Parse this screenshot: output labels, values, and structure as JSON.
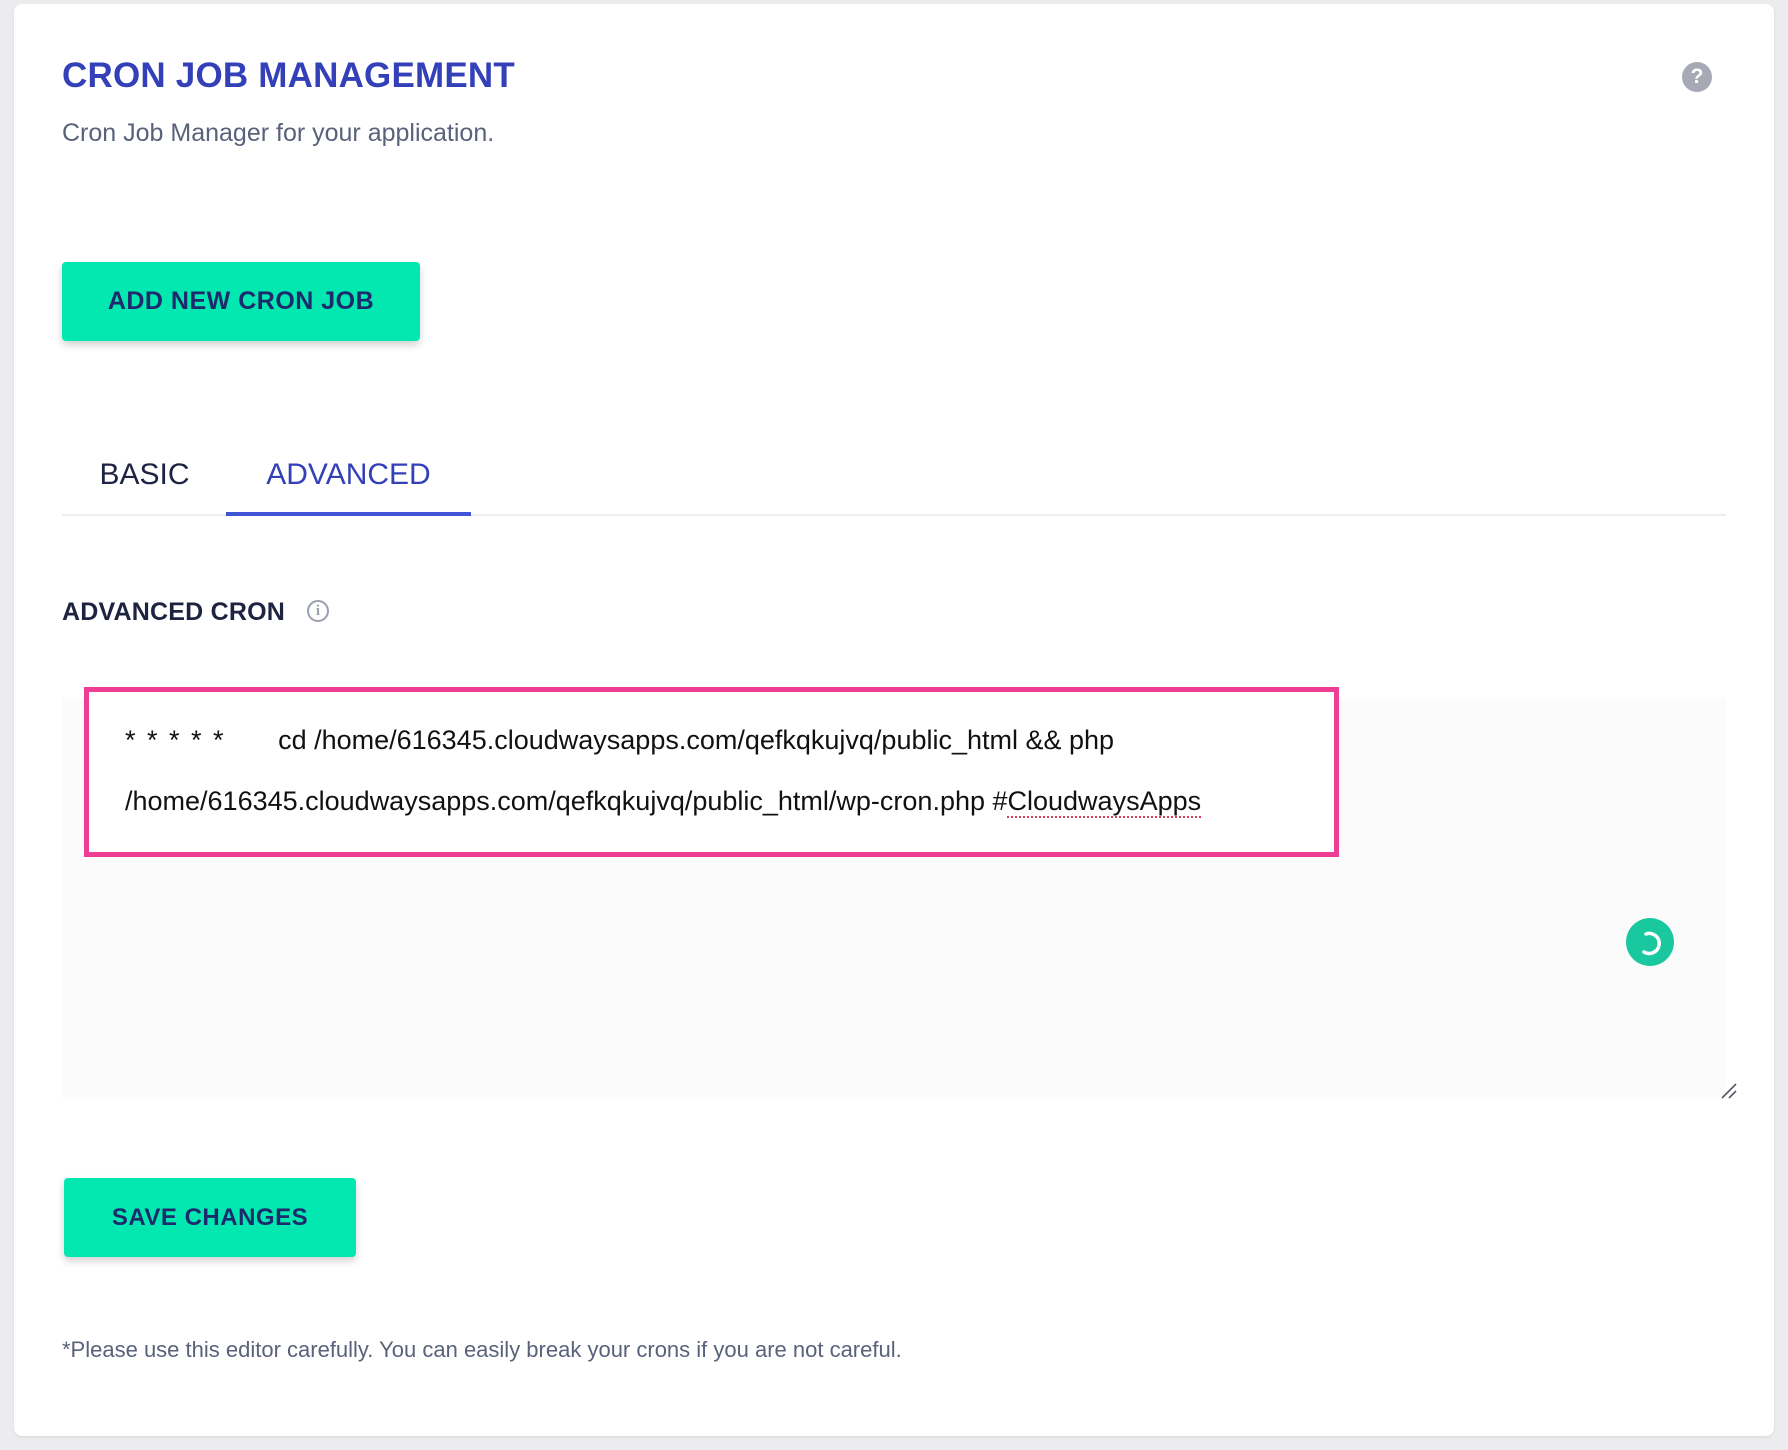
{
  "header": {
    "title": "CRON JOB MANAGEMENT",
    "subtitle": "Cron Job Manager for your application.",
    "help_icon": "question-circle-icon",
    "help_glyph": "?"
  },
  "actions": {
    "add_label": "ADD NEW CRON JOB",
    "save_label": "SAVE CHANGES"
  },
  "tabs": [
    {
      "label": "BASIC",
      "active": false
    },
    {
      "label": "ADVANCED",
      "active": true
    }
  ],
  "advanced": {
    "section_title": "ADVANCED CRON",
    "info_icon": "info-circle-icon",
    "info_glyph": "i",
    "cron_schedule": "* * * * *",
    "cron_command_part1": "cd /home/616345.cloudwaysapps.com/qefkqkujvq/public_html && php",
    "cron_command_part2_prefix": "/home/616345.cloudwaysapps.com/qefkqkujvq/public_html/wp-cron.php #",
    "cron_command_part2_flagged": "CloudwaysApps",
    "status_icon": "loading-spinner-icon",
    "resize_icon": "resize-handle-icon"
  },
  "footnote": "*Please use this editor carefully. You can easily break your crons if you are not careful.",
  "colors": {
    "accent": "#3340b8",
    "button_bg": "#03e8b0",
    "button_text": "#1d2a6b",
    "highlight_border": "#ef3d96",
    "spinner": "#1ac8a0"
  }
}
